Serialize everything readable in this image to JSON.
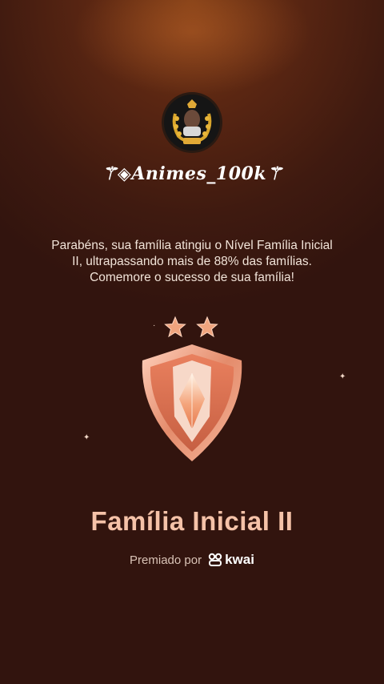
{
  "profile": {
    "username": "⚚◈Animes_100k⚚"
  },
  "congrats": {
    "message": "Parabéns, sua família atingiu o Nível Família Inicial II, ultrapassando mais de 88% das famílias. Comemore o sucesso de sua família!"
  },
  "level": {
    "title": "Família Inicial II",
    "stars": 2
  },
  "award": {
    "label": "Premiado por",
    "brand": "kwai"
  },
  "icons": {
    "avatar": "user-avatar-with-gold-laurel",
    "star": "star-icon",
    "badge": "shield-badge-icon",
    "brand_logo": "kwai-logo-icon",
    "sparkle": "sparkle-icon"
  },
  "colors": {
    "background": "#3f1a10",
    "title": "#f5c2a8",
    "badge_primary": "#e9967a",
    "star": "#f0a47e"
  }
}
